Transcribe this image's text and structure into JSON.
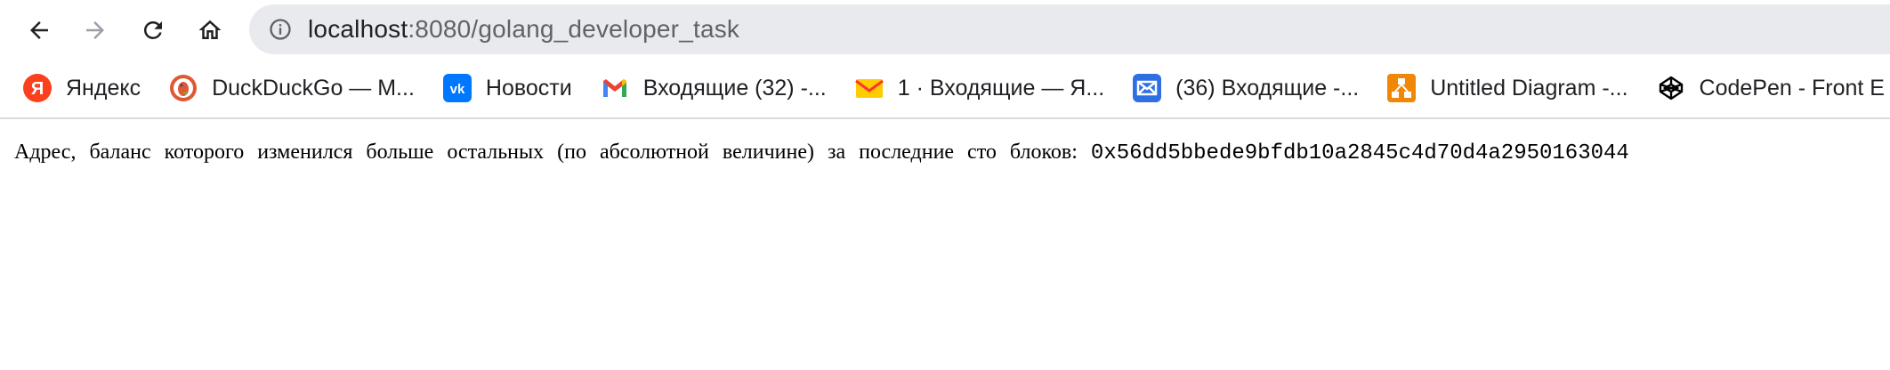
{
  "address_bar": {
    "url_host": "localhost",
    "url_rest": ":8080/golang_developer_task"
  },
  "bookmarks": [
    {
      "label": "Яндекс",
      "icon": "yandex-icon",
      "color": "#fc3f1d"
    },
    {
      "label": "DuckDuckGo — M...",
      "icon": "duckduckgo-icon",
      "color": "#de5833"
    },
    {
      "label": "Новости",
      "icon": "vk-icon",
      "color": "#0077ff"
    },
    {
      "label": "Входящие (32) -...",
      "icon": "gmail-icon",
      "color": "#ea4335"
    },
    {
      "label": "1 · Входящие — Я...",
      "icon": "yandex-mail-icon",
      "color": "#ffcc00"
    },
    {
      "label": "(36) Входящие -...",
      "icon": "mail-icon",
      "color": "#2f6fe4"
    },
    {
      "label": "Untitled Diagram -...",
      "icon": "drawio-icon",
      "color": "#f08705"
    },
    {
      "label": "CodePen - Front E",
      "icon": "codepen-icon",
      "color": "#000000"
    }
  ],
  "page": {
    "message": "Адрес, баланс которого изменился больше остальных (по абсолютной величине) за последние сто блоков:",
    "address": "0x56dd5bbede9bfdb10a2845c4d70d4a2950163044"
  }
}
